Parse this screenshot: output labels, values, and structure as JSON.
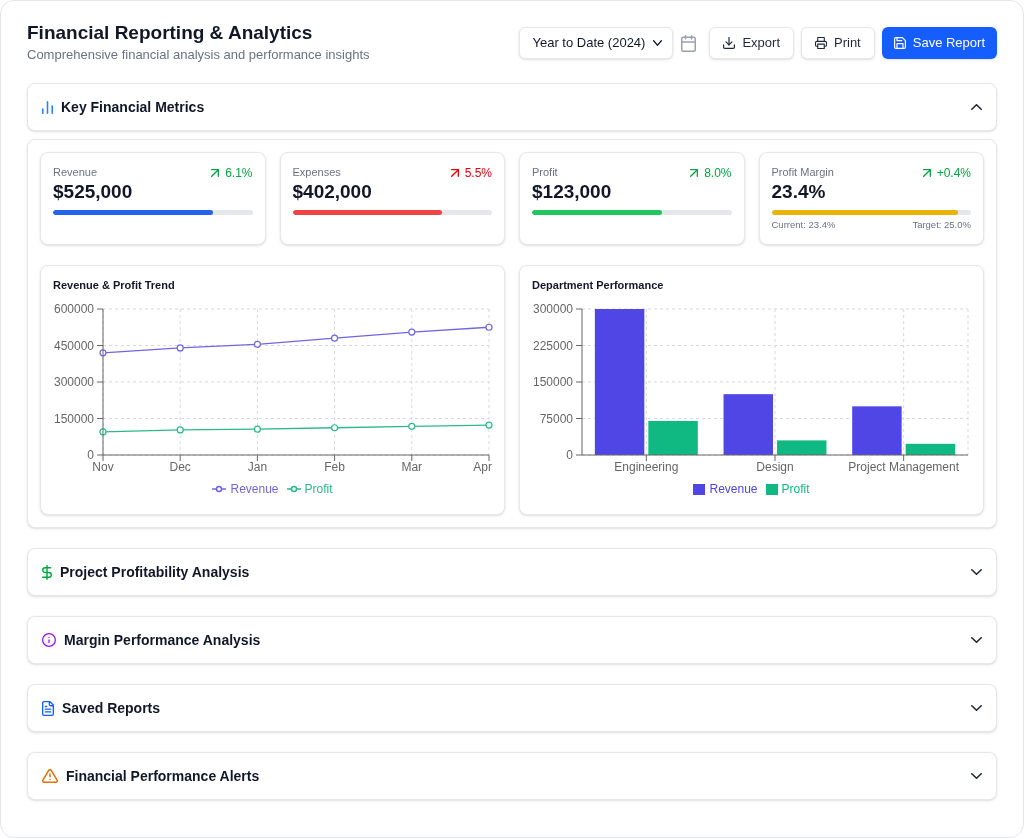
{
  "header": {
    "title": "Financial Reporting & Analytics",
    "subtitle": "Comprehensive financial analysis and performance insights"
  },
  "toolbar": {
    "period": {
      "value": "Year to Date (2024)"
    },
    "buttons": [
      {
        "label": "Export",
        "kind": "secondary"
      },
      {
        "label": "Print",
        "kind": "secondary"
      },
      {
        "label": "Save Report",
        "kind": "primary"
      }
    ]
  },
  "sections": [
    {
      "title": "Key Financial Metrics",
      "expanded": true,
      "metrics": [
        {
          "label": "Revenue",
          "value": "$525,000",
          "change": "6.1%",
          "favorable": true,
          "level": 0.8,
          "color": "#2563eb"
        },
        {
          "label": "Expenses",
          "value": "$402,000",
          "change": "5.5%",
          "favorable": false,
          "level": 0.75,
          "color": "#ef4444"
        },
        {
          "label": "Profit",
          "value": "$123,000",
          "change": "8.0%",
          "favorable": true,
          "level": 0.65,
          "color": "#22c55e"
        },
        {
          "label": "Profit Margin",
          "value": "23.4%",
          "change": "+0.4%",
          "favorable": true,
          "level": 0.936,
          "color": "#eab308",
          "current": "Current: 23.4%",
          "target": "Target: 25.0%"
        }
      ],
      "charts": [
        {
          "chart_data": {
            "type": "line",
            "title": "Revenue & Profit Trend",
            "categories": [
              "Nov",
              "Dec",
              "Jan",
              "Feb",
              "Mar",
              "Apr"
            ],
            "series": [
              {
                "name": "Revenue",
                "color": "#7066e0",
                "marker": "circle",
                "values": [
                  420000,
                  440000,
                  455000,
                  480000,
                  505000,
                  525000
                ]
              },
              {
                "name": "Profit",
                "color": "#2bb98a",
                "marker": "circle",
                "values": [
                  95000,
                  103000,
                  106000,
                  112000,
                  118000,
                  123000
                ]
              }
            ],
            "ylim": [
              0,
              600000
            ],
            "yticks": [
              0,
              150000,
              300000,
              450000,
              600000
            ],
            "grid": true,
            "legend": "bottom"
          }
        },
        {
          "chart_data": {
            "type": "bar",
            "title": "Department Performance",
            "categories": [
              "Engineering",
              "Design",
              "Project Management"
            ],
            "series": [
              {
                "name": "Revenue",
                "color": "#4f46e5",
                "values": [
                  300000,
                  125000,
                  100000
                ]
              },
              {
                "name": "Profit",
                "color": "#10b981",
                "values": [
                  70000,
                  30000,
                  23000
                ]
              }
            ],
            "ylim": [
              0,
              300000
            ],
            "yticks": [
              0,
              75000,
              150000,
              225000,
              300000
            ],
            "grid": true,
            "legend": "bottom"
          }
        }
      ]
    },
    {
      "title": "Project Profitability Analysis",
      "expanded": false
    },
    {
      "title": "Margin Performance Analysis",
      "expanded": false
    },
    {
      "title": "Saved Reports",
      "expanded": false
    },
    {
      "title": "Financial Performance Alerts",
      "expanded": false
    }
  ]
}
